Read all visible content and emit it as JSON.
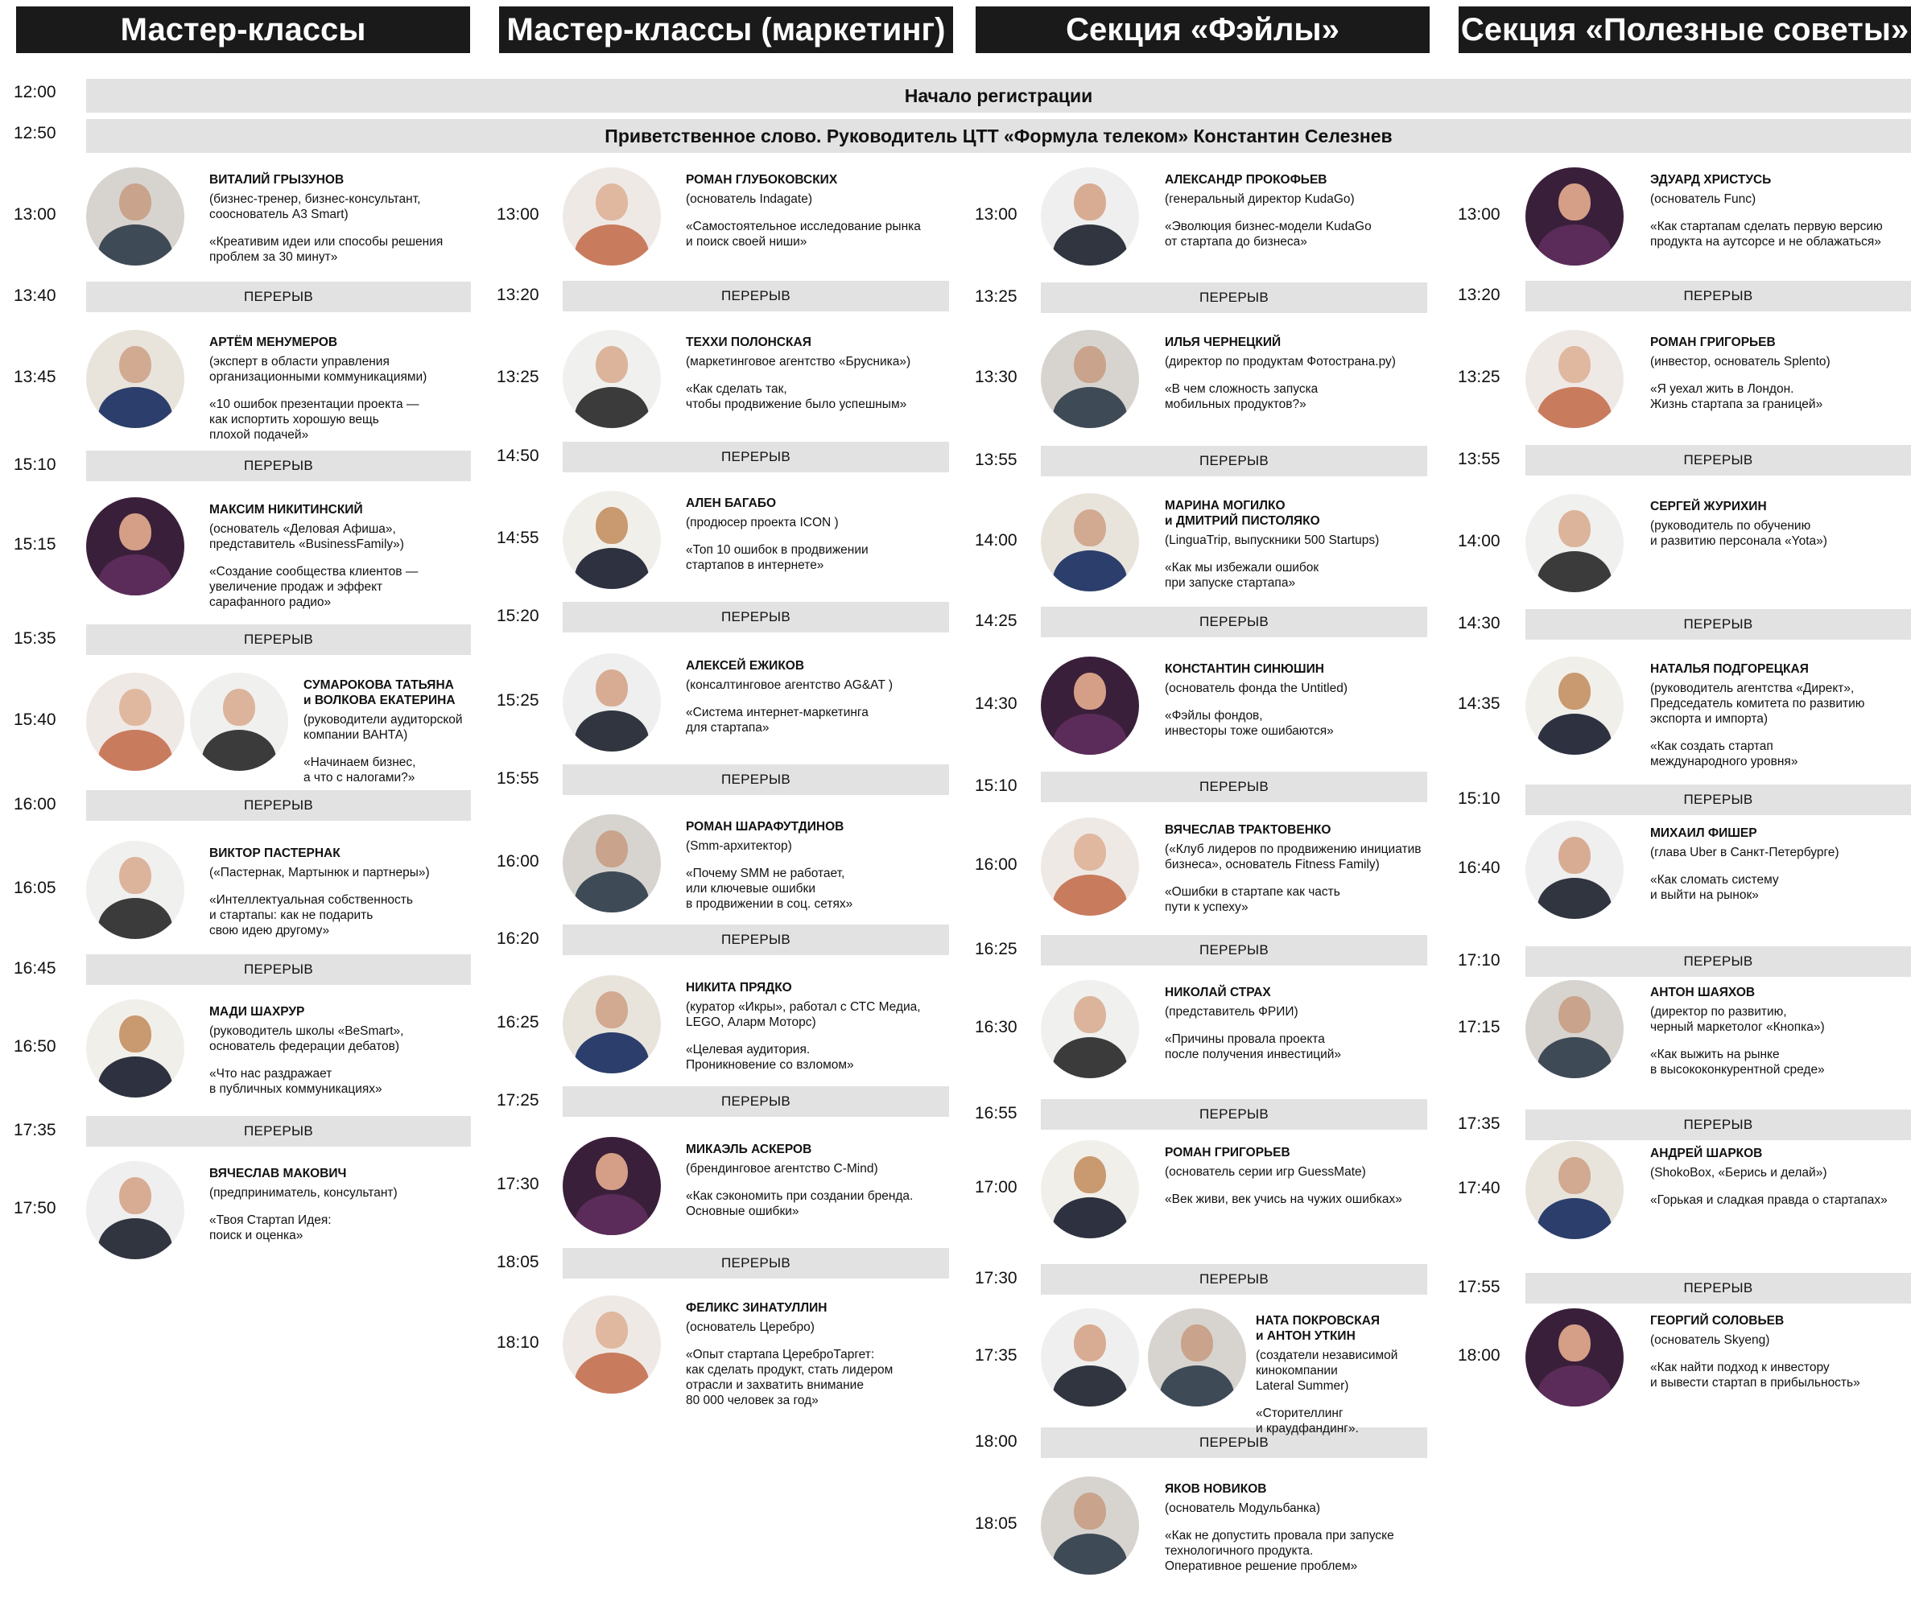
{
  "columns": [
    "Мастер-классы",
    "Мастер-классы (маркетинг)",
    "Секция «Фэйлы»",
    "Секция «Полезные советы»"
  ],
  "common": [
    {
      "time": "12:00",
      "label": "Начало регистрации"
    },
    {
      "time": "12:50",
      "label": "Приветственное слово. Руководитель ЦТТ «Формула телеком» Константин Селезнев"
    }
  ],
  "break_label": "ПЕРЕРЫВ",
  "col1": {
    "talks": [
      {
        "time": "13:00",
        "name": "ВИТАЛИЙ ГРЫЗУНОВ",
        "role": "(бизнес-тренер, бизнес-консультант,\nсооснователь A3 Smart)",
        "topic": "«Креативим идеи или способы решения\nпроблем за 30 минут»"
      },
      {
        "time": "13:45",
        "name": "АРТЁМ МЕНУМЕРОВ",
        "role": "(эксперт в области управления\nорганизационными коммуникациями)",
        "topic": "«10 ошибок презентации проекта —\nкак испортить хорошую вещь\nплохой подачей»"
      },
      {
        "time": "15:15",
        "name": "МАКСИМ НИКИТИНСКИЙ",
        "role": "(основатель «Деловая Афиша»,\nпредставитель «BusinessFamily»)",
        "topic": "«Создание сообщества клиентов —\nувеличение продаж и эффект\nсарафанного радио»"
      },
      {
        "time": "15:40",
        "name": "СУМАРОКОВА ТАТЬЯНА\nи ВОЛКОВА ЕКАТЕРИНА",
        "role": "(руководители аудиторской\nкомпании ВАНТА)",
        "topic": "«Начинаем бизнес,\nа что с налогами?»"
      },
      {
        "time": "16:05",
        "name": "ВИКТОР ПАСТЕРНАК",
        "role": "(«Пастернак, Мартынюк и партнеры»)",
        "topic": "«Интеллектуальная собственность\nи стартапы: как не подарить\nсвою идею другому»"
      },
      {
        "time": "16:50",
        "name": "МАДИ ШАХРУР",
        "role": "(руководитель школы «BeSmart»,\nоснователь федерации дебатов)",
        "topic": "«Что нас раздражает\nв публичных коммуникациях»"
      },
      {
        "time": "17:50",
        "name": "ВЯЧЕСЛАВ МАКОВИЧ",
        "role": "(предприниматель, консультант)",
        "topic": "«Твоя Стартап Идея:\nпоиск и оценка»"
      }
    ],
    "breaks": [
      "13:40",
      "15:10",
      "15:35",
      "16:00",
      "16:45",
      "17:35"
    ]
  },
  "col2": {
    "talks": [
      {
        "time": "13:00",
        "name": "РОМАН ГЛУБОКОВСКИХ",
        "role": "(основатель Indagate)",
        "topic": "«Самостоятельное исследование рынка\nи поиск своей ниши»"
      },
      {
        "time": "13:25",
        "name": "ТЕХХИ ПОЛОНСКАЯ",
        "role": "(маркетинговое агентство «Брусника»)",
        "topic": "«Как сделать так,\nчтобы продвижение было успешным»"
      },
      {
        "time": "14:55",
        "name": "АЛЕН БАГАБО",
        "role": "(продюсер проекта ICON )",
        "topic": "«Топ 10 ошибок в продвижении\nстартапов в интернете»"
      },
      {
        "time": "15:25",
        "name": "АЛЕКСЕЙ ЕЖИКОВ",
        "role": "(консалтинговое агентство AG&AT )",
        "topic": "«Система интернет-маркетинга\nдля стартапа»"
      },
      {
        "time": "16:00",
        "name": "РОМАН ШАРАФУТДИНОВ",
        "role": "(Smm-архитектор)",
        "topic": "«Почему SMM не работает,\nили ключевые ошибки\nв продвижении в соц. сетях»"
      },
      {
        "time": "16:25",
        "name": "НИКИТА ПРЯДКО",
        "role": "(куратор «Икры», работал с СТС Медиа,\nLEGO, Аларм Моторс)",
        "topic": "«Целевая аудитория.\nПроникновение со взломом»"
      },
      {
        "time": "17:30",
        "name": "МИКАЭЛЬ АСКЕРОВ",
        "role": "(брендинговое агентство C-Mind)",
        "topic": "«Как сэкономить при создании бренда.\nОсновные ошибки»"
      },
      {
        "time": "18:10",
        "name": "ФЕЛИКС ЗИНАТУЛЛИН",
        "role": "(основатель Церебро)",
        "topic": "«Опыт стартапа ЦереброТаргет:\nкак сделать продукт, стать лидером\nотрасли и захватить внимание\n80 000 человек за год»"
      }
    ],
    "breaks": [
      "13:20",
      "14:50",
      "15:20",
      "15:55",
      "16:20",
      "17:25",
      "18:05"
    ]
  },
  "col3": {
    "talks": [
      {
        "time": "13:00",
        "name": "АЛЕКСАНДР ПРОКОФЬЕВ",
        "role": "(генеральный директор KudaGo)",
        "topic": "«Эволюция бизнес-модели KudaGo\nот стартапа до бизнеса»"
      },
      {
        "time": "13:30",
        "name": "ИЛЬЯ ЧЕРНЕЦКИЙ",
        "role": "(директор по продуктам Фотострана.ру)",
        "topic": "«В чем сложность запуска\nмобильных продуктов?»"
      },
      {
        "time": "14:00",
        "name": "МАРИНА МОГИЛКО\nи ДМИТРИЙ ПИСТОЛЯКО",
        "role": "(LinguaTrip, выпускники 500 Startups)",
        "topic": "«Как мы избежали ошибок\nпри запуске стартапа»"
      },
      {
        "time": "14:30",
        "name": "КОНСТАНТИН СИНЮШИН",
        "role": "(основатель фонда the Untitled)",
        "topic": "«Фэйлы фондов,\nинвесторы тоже ошибаются»"
      },
      {
        "time": "16:00",
        "name": "ВЯЧЕСЛАВ ТРАКТОВЕНКО",
        "role": "(«Клуб лидеров по продвижению инициатив\nбизнеса», основатель Fitness Family)",
        "topic": "«Ошибки в стартапе как часть\nпути к успеху»"
      },
      {
        "time": "16:30",
        "name": "НИКОЛАЙ СТРАХ",
        "role": "(представитель ФРИИ)",
        "topic": "«Причины провала проекта\nпосле получения инвестиций»"
      },
      {
        "time": "17:00",
        "name": "РОМАН ГРИГОРЬЕВ",
        "role": "(основатель серии игр GuessMate)",
        "topic": "«Век живи, век учись на чужих ошибках»"
      },
      {
        "time": "17:35",
        "name": "НАТА ПОКРОВСКАЯ\nи АНТОН УТКИН",
        "role": "(создатели независимой\nкинокомпании\nLateral Summer)",
        "topic": "«Сторителлинг\nи краудфандинг»."
      },
      {
        "time": "18:05",
        "name": "ЯКОВ НОВИКОВ",
        "role": "(основатель Модульбанка)",
        "topic": "«Как не допустить провала при запуске\nтехнологичного продукта.\nОперативное решение проблем»"
      }
    ],
    "breaks": [
      "13:25",
      "13:55",
      "14:25",
      "15:10",
      "16:25",
      "16:55",
      "17:30",
      "18:00"
    ]
  },
  "col4": {
    "talks": [
      {
        "time": "13:00",
        "name": "ЭДУАРД ХРИСТУСЬ",
        "role": "(основатель Func)",
        "topic": "«Как стартапам сделать первую версию\nпродукта на аутсорсе и не облажаться»"
      },
      {
        "time": "13:25",
        "name": "РОМАН ГРИГОРЬЕВ",
        "role": "(инвестор, основатель Splento)",
        "topic": "«Я уехал жить в Лондон.\nЖизнь стартапа за границей»"
      },
      {
        "time": "14:00",
        "name": "СЕРГЕЙ ЖУРИХИН",
        "role": "(руководитель по обучению\nи развитию персонала «Yota»)",
        "topic": ""
      },
      {
        "time": "14:35",
        "name": "НАТАЛЬЯ ПОДГОРЕЦКАЯ",
        "role": "(руководитель агентства «Директ»,\nПредседатель комитета по развитию\nэкспорта и импорта)",
        "topic": "«Как создать стартап\nмеждународного уровня»"
      },
      {
        "time": "16:40",
        "name": "МИХАИЛ ФИШЕР",
        "role": "(глава Uber в Санкт-Петербурге)",
        "topic": "«Как сломать систему\nи выйти на рынок»"
      },
      {
        "time": "17:15",
        "name": "АНТОН ШАЯХОВ",
        "role": "(директор по развитию,\nчерный маркетолог «Кнопка»)",
        "topic": "«Как выжить на рынке\nв высококонкурентной среде»"
      },
      {
        "time": "17:40",
        "name": "АНДРЕЙ ШАРКОВ",
        "role": "(ShokoBox, «Берись и делай»)",
        "topic": "«Горькая и сладкая правда о стартапах»"
      },
      {
        "time": "18:00",
        "name": "ГЕОРГИЙ СОЛОВЬЕВ",
        "role": "(основатель Skyeng)",
        "topic": "«Как найти подход к инвестору\nи вывести стартап в прибыльность»"
      }
    ],
    "breaks": [
      "13:20",
      "13:55",
      "14:30",
      "15:10",
      "17:10",
      "17:35",
      "17:55"
    ]
  }
}
